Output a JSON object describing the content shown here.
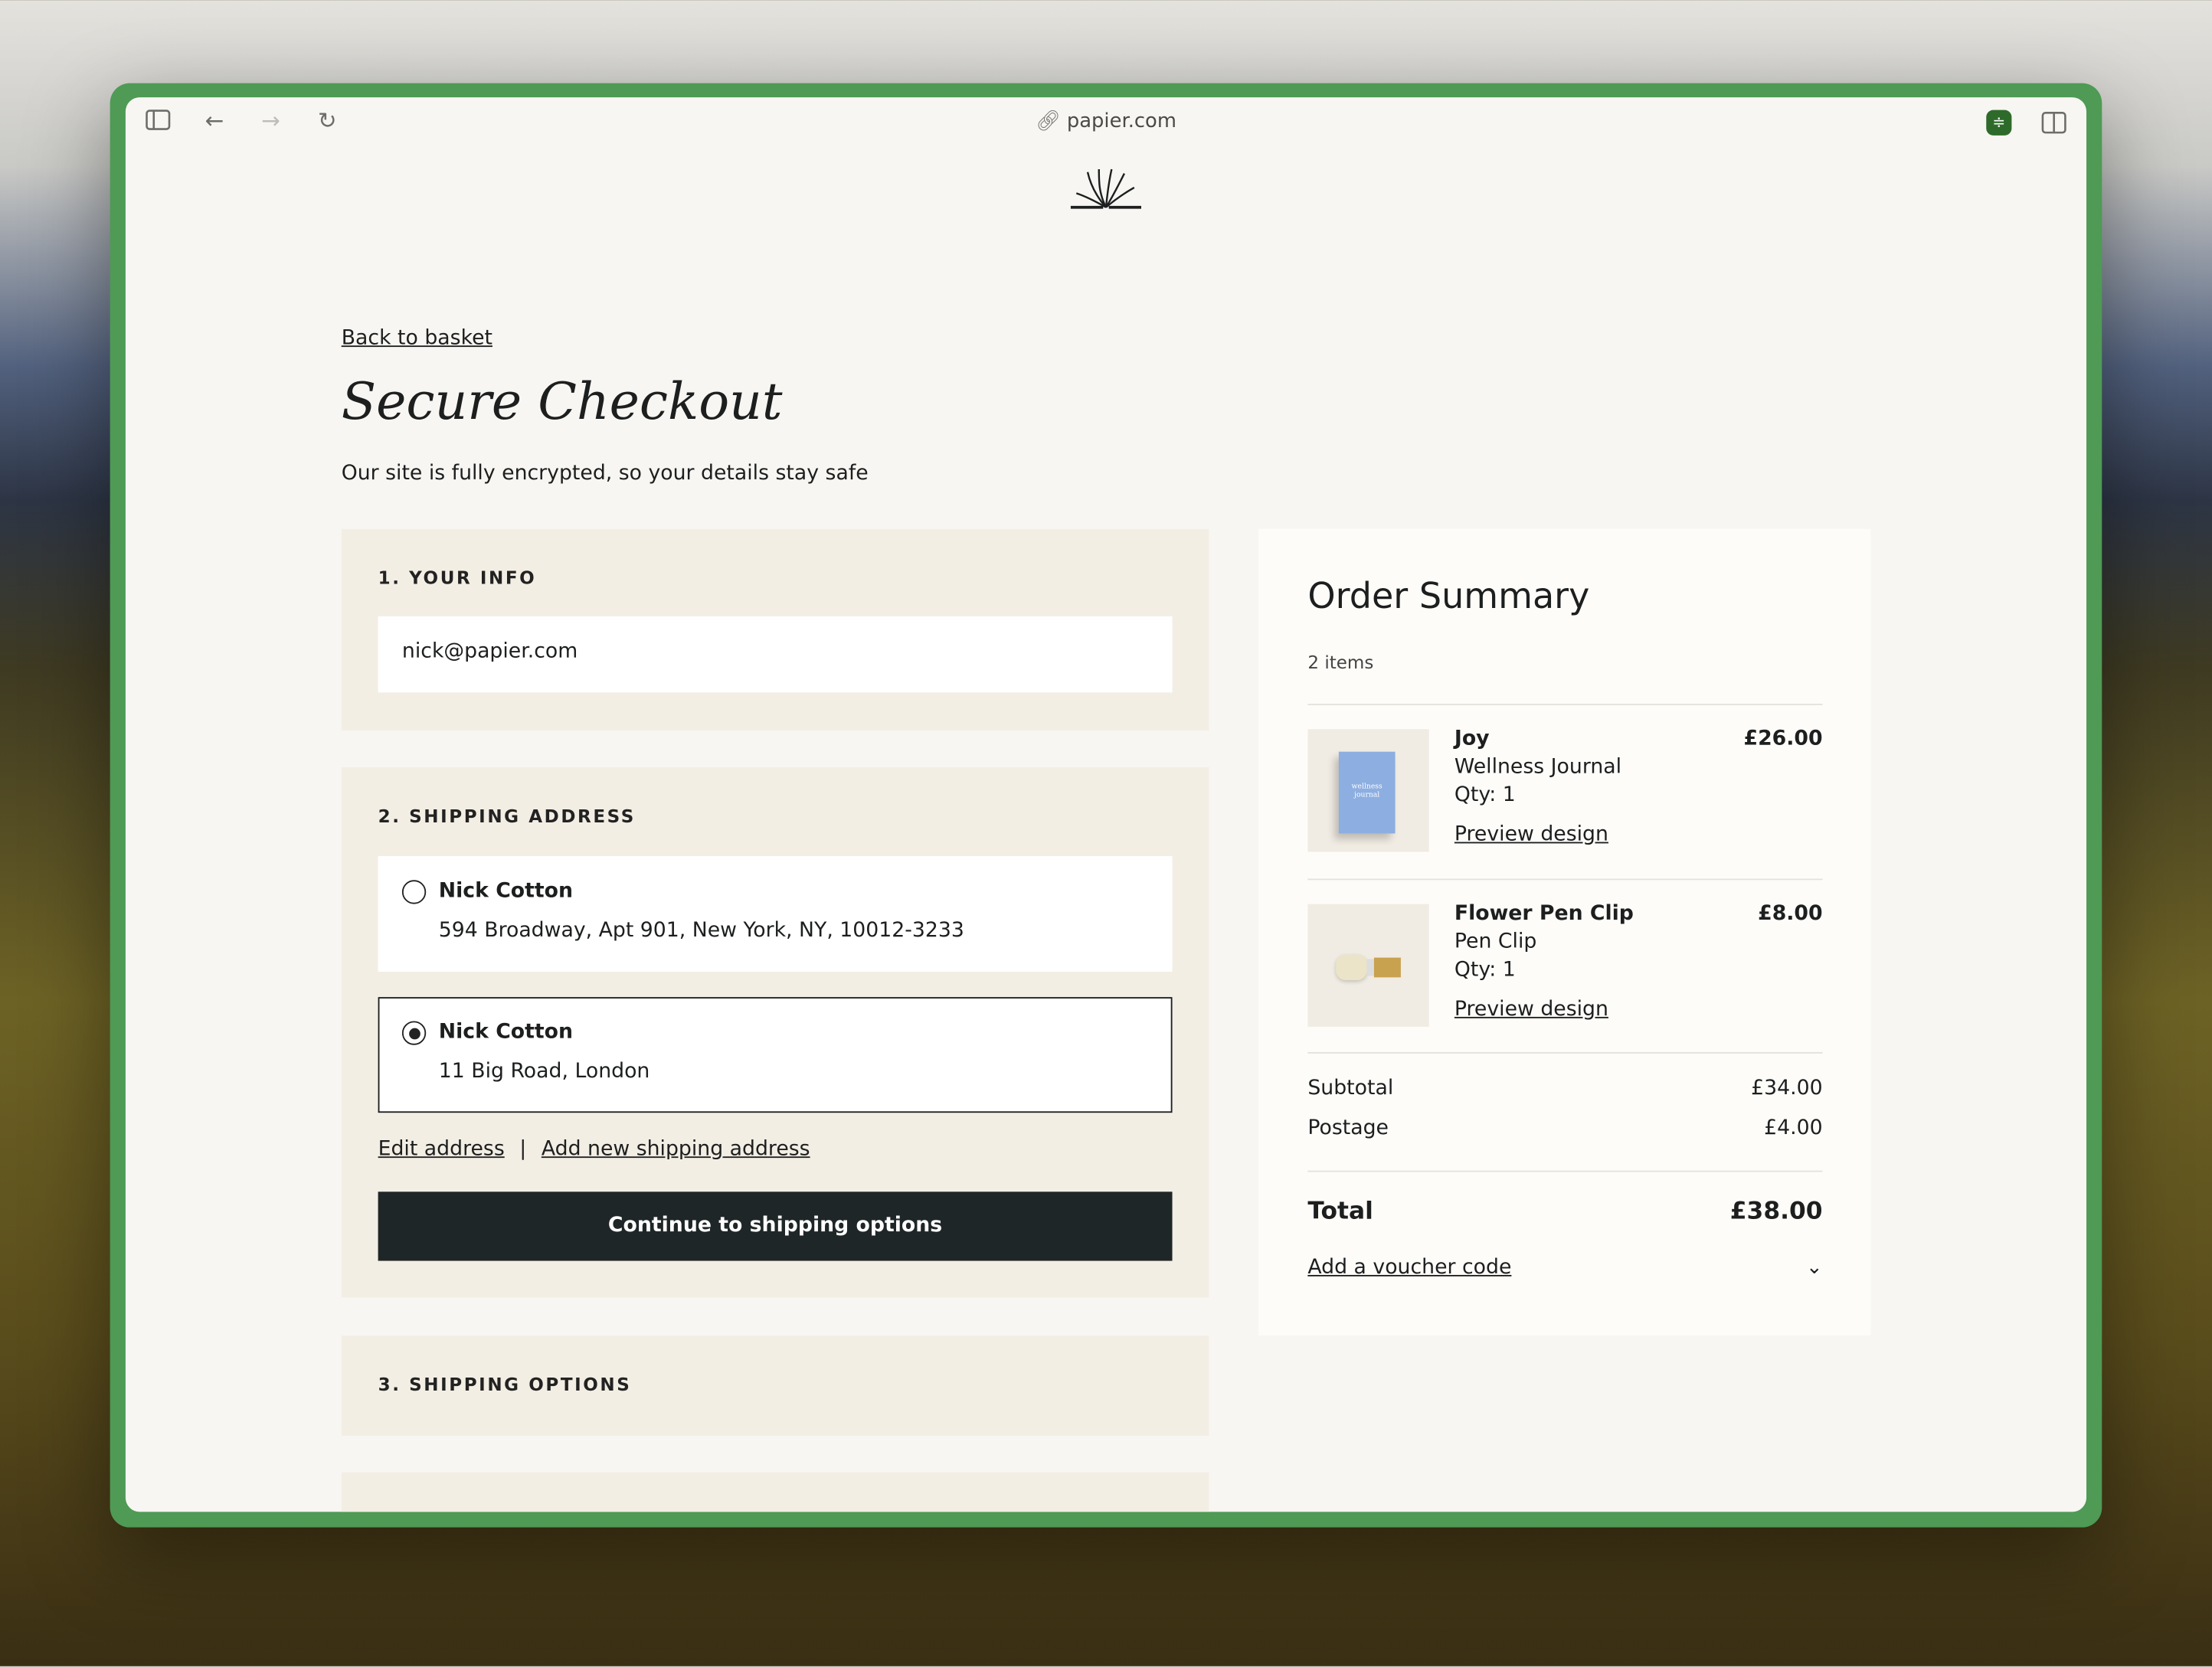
{
  "browser": {
    "url": "papier.com",
    "icons": [
      "sidebar-icon",
      "back-arrow-icon",
      "forward-arrow-icon",
      "reload-icon",
      "link-icon",
      "extension-sliders-icon",
      "split-view-icon"
    ],
    "accent": "#2e6b2a"
  },
  "header": {
    "logo": "papier sunburst logo"
  },
  "checkout": {
    "back_link": "Back to basket",
    "title": "Secure Checkout",
    "subtitle": "Our site is fully encrypted, so your details stay safe",
    "your_info": {
      "label": "1. YOUR INFO",
      "email": "nick@papier.com"
    },
    "shipping": {
      "label": "2. SHIPPING ADDRESS",
      "addresses": [
        {
          "name": "Nick Cotton",
          "address": "594 Broadway, Apt 901, New York, NY, 10012-3233",
          "selected": false
        },
        {
          "name": "Nick Cotton",
          "address": "11 Big Road, London",
          "selected": true
        }
      ],
      "edit": "Edit address",
      "separator": "|",
      "add": "Add new shipping address",
      "continue": "Continue to shipping options"
    },
    "shipping_options": {
      "label": "3. SHIPPING OPTIONS"
    }
  },
  "summary": {
    "title": "Order Summary",
    "count": "2 items",
    "items": [
      {
        "name": "Joy",
        "type": "Wellness Journal",
        "qty": "Qty: 1",
        "price": "£26.00",
        "preview": "Preview design",
        "cover_text": "wellness journal"
      },
      {
        "name": "Flower Pen Clip",
        "type": "Pen Clip",
        "qty": "Qty: 1",
        "price": "£8.00",
        "preview": "Preview design"
      }
    ],
    "subtotal_label": "Subtotal",
    "subtotal": "£34.00",
    "postage_label": "Postage",
    "postage": "£4.00",
    "total_label": "Total",
    "total": "£38.00",
    "voucher": "Add a voucher code"
  }
}
